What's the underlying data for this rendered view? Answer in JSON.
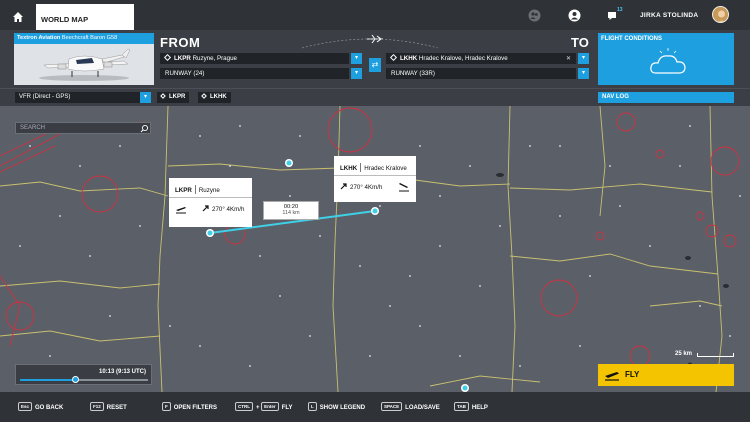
{
  "topbar": {
    "tab_label": "WORLD MAP",
    "notifications_count": "13",
    "user_name": "JIRKA STOLINDA"
  },
  "aircraft": {
    "brand": "Textron Aviation",
    "model": "Beechcraft Baron G58"
  },
  "from": {
    "label": "FROM",
    "icao": "LKPR",
    "airport": "Ruzyne, Prague",
    "runway": "RUNWAY (24)"
  },
  "to": {
    "label": "TO",
    "icao": "LKHK",
    "airport": "Hradec Kralove, Hradec Kralove",
    "runway": "RUNWAY (33R)"
  },
  "conditions": {
    "title": "FLIGHT CONDITIONS"
  },
  "route": {
    "mode": "VFR (Direct - GPS)",
    "waypoints": [
      "LKPR",
      "LKHK"
    ],
    "nav_log": "NAV LOG"
  },
  "search": {
    "placeholder": "SEARCH"
  },
  "map": {
    "origin_card": {
      "icao": "LKPR",
      "name": "Ruzyne",
      "wind": "270° 4Km/h"
    },
    "dest_card": {
      "icao": "LKHK",
      "name": "Hradec Kralove",
      "wind": "270° 4Km/h"
    },
    "leg": {
      "time": "00:20",
      "distance": "114 km"
    },
    "scale": "25 km"
  },
  "time": {
    "display": "10:13 (9:13 UTC)",
    "progress": 0.43
  },
  "fly": {
    "label": "FLY"
  },
  "hints": [
    {
      "keys": [
        "Esc"
      ],
      "label": "GO BACK"
    },
    {
      "keys": [
        "F12"
      ],
      "label": "RESET"
    },
    {
      "keys": [
        "F"
      ],
      "label": "OPEN FILTERS"
    },
    {
      "keys": [
        "CTRL",
        "+",
        "Enter"
      ],
      "label": "FLY"
    },
    {
      "keys": [
        "L"
      ],
      "label": "SHOW LEGEND"
    },
    {
      "keys": [
        "SPACE"
      ],
      "label": "LOAD/SAVE"
    },
    {
      "keys": [
        "TAB"
      ],
      "label": "HELP"
    }
  ],
  "colors": {
    "accent": "#1d9fe0",
    "route_line": "#3fd0e8",
    "fly_button": "#f5c400",
    "airspace": "#d03040",
    "border_lines": "#c9c070"
  }
}
